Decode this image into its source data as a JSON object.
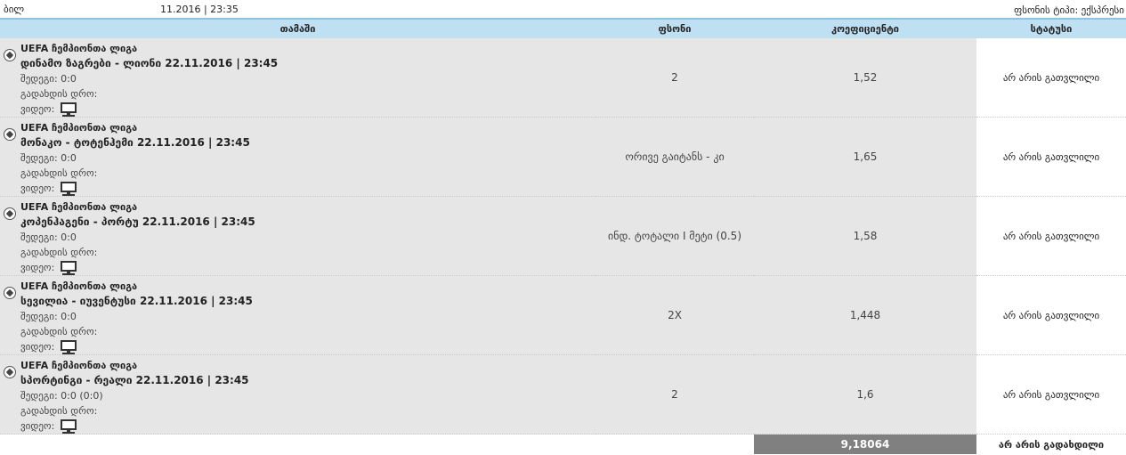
{
  "header": {
    "date_prefix": "ბილ",
    "date_suffix": "11.2016 | 23:35",
    "bet_type_label": "ფსონის ტიპი: ექსპრესი"
  },
  "columns": {
    "game": "თამაში",
    "bet": "ფსონი",
    "coef": "კოეფიციენტი",
    "status": "სტატუსი"
  },
  "labels": {
    "score": "შედეგი:",
    "live_time": "გადახდის დრო:",
    "video": "ვიდეო:"
  },
  "rows": [
    {
      "league": "UEFA ჩემპიონთა ლიგა",
      "match": "დინამო ზაგრები - ლიონი 22.11.2016 | 23:45",
      "score": "0:0",
      "bet": "2",
      "coef": "1,52",
      "status": "არ არის გათვლილი"
    },
    {
      "league": "UEFA ჩემპიონთა ლიგა",
      "match": "მონაკო - ტოტენჰემი 22.11.2016 | 23:45",
      "score": "0:0",
      "bet": "ორივე გაიტანს - კი",
      "coef": "1,65",
      "status": "არ არის გათვლილი"
    },
    {
      "league": "UEFA ჩემპიონთა ლიგა",
      "match": "კოპენჰაგენი - პორტუ 22.11.2016 | 23:45",
      "score": "0:0",
      "bet": "ინდ. ტოტალი I მეტი (0.5)",
      "coef": "1,58",
      "status": "არ არის გათვლილი"
    },
    {
      "league": "UEFA ჩემპიონთა ლიგა",
      "match": "სევილია - იუვენტუსი 22.11.2016 | 23:45",
      "score": "0:0",
      "bet": "2X",
      "coef": "1,448",
      "status": "არ არის გათვლილი"
    },
    {
      "league": "UEFA ჩემპიონთა ლიგა",
      "match": "სპორტინგი - რეალი 22.11.2016 | 23:45",
      "score": "0:0 (0:0)",
      "bet": "2",
      "coef": "1,6",
      "status": "არ არის გათვლილი"
    }
  ],
  "footer": {
    "total_coef": "9,18064",
    "overall_status": "არ არის გადახდილი"
  },
  "colors": {
    "header_bg": "#bfe0f2",
    "row_bg": "#e6e6e6",
    "total_bg": "#808080"
  },
  "icons": {
    "sport": "soccer-ball-icon",
    "video": "tv-monitor-icon"
  }
}
